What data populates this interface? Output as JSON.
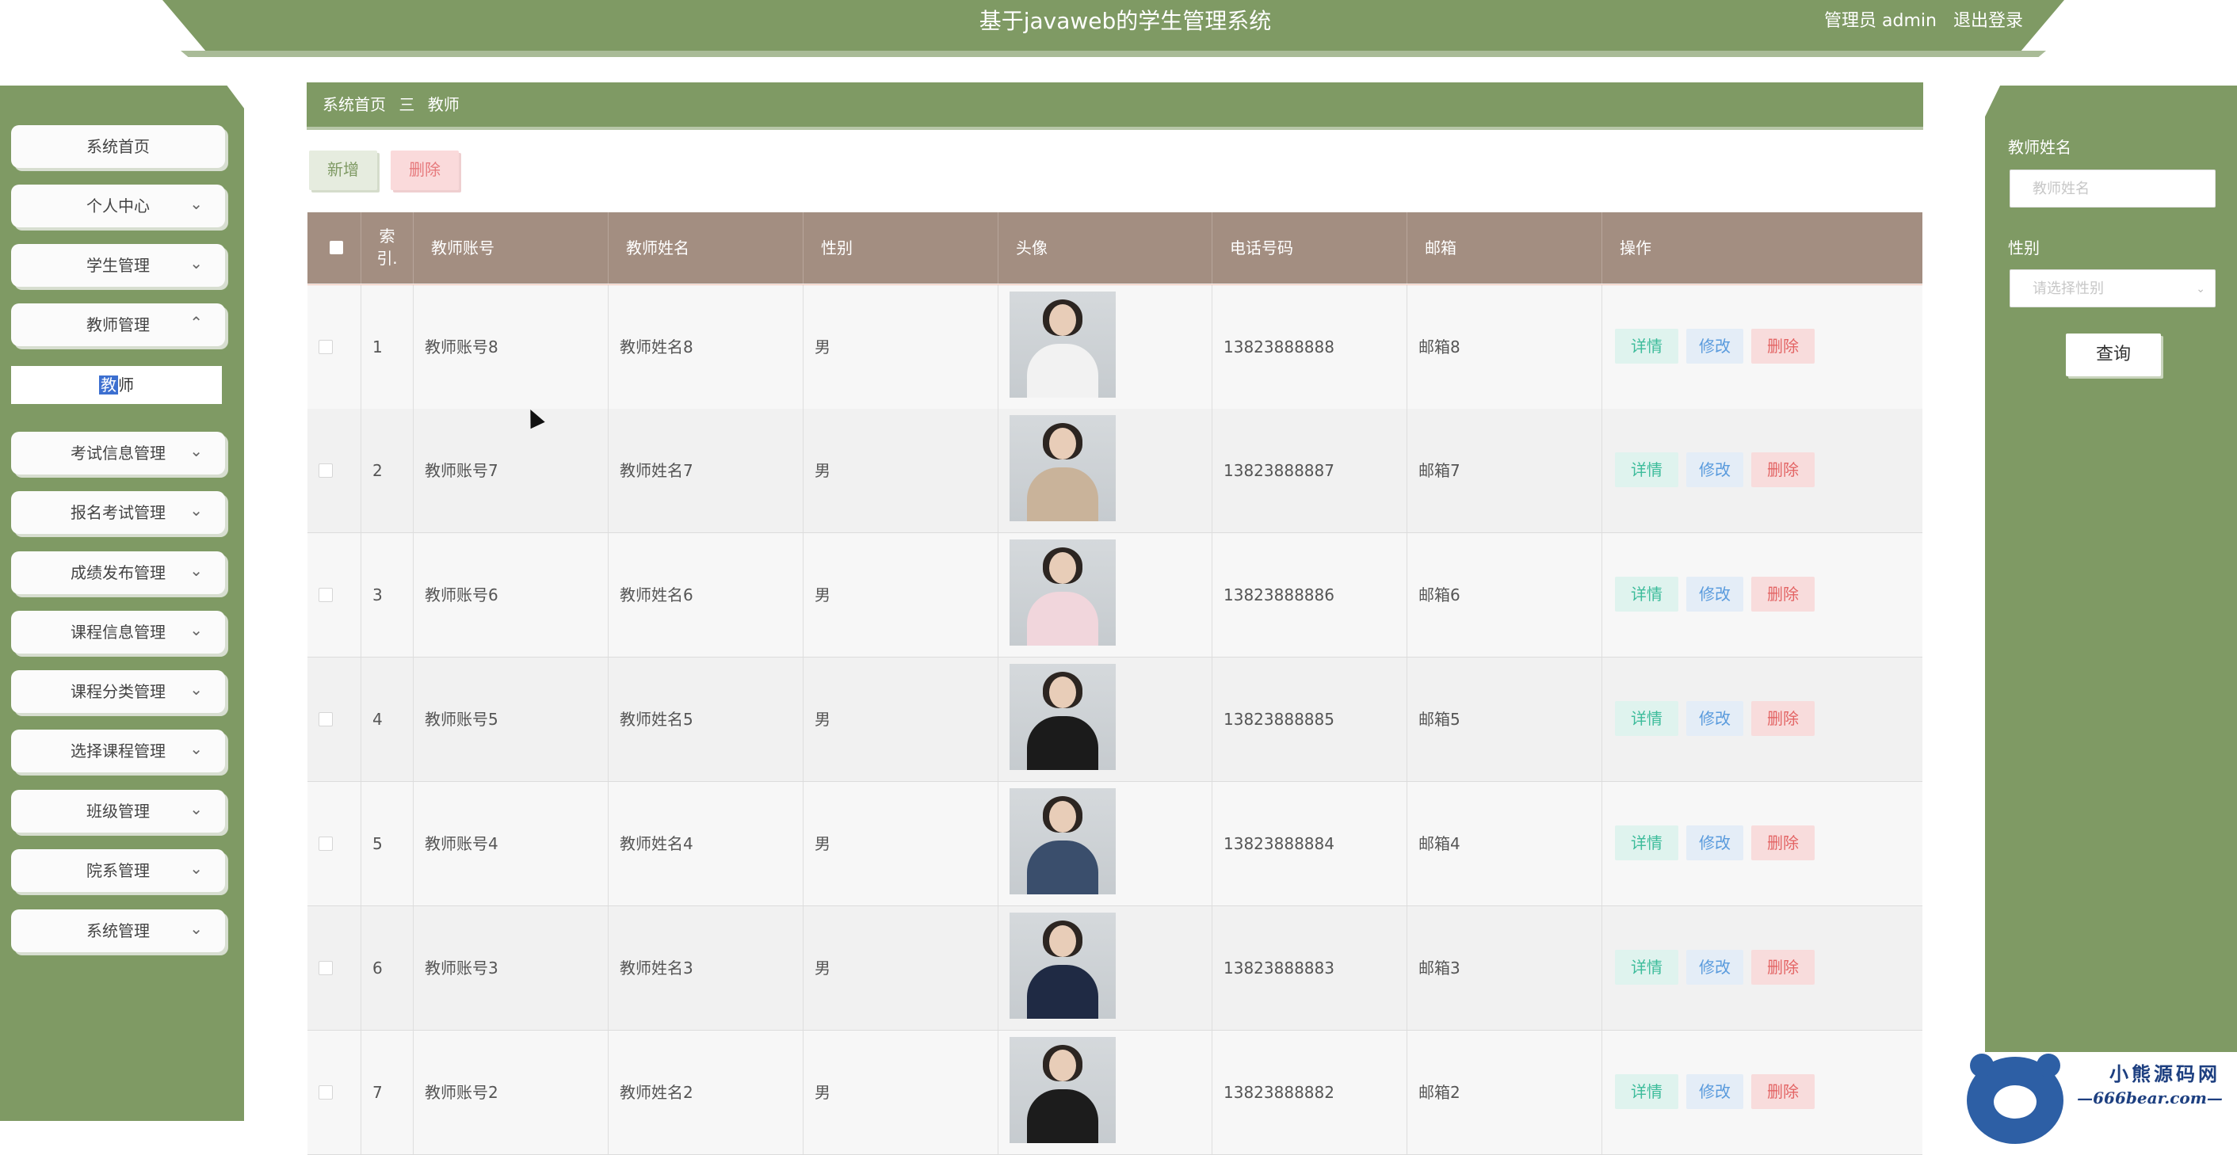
{
  "header": {
    "title": "基于javaweb的学生管理系统",
    "user_label": "管理员 admin",
    "logout_label": "退出登录"
  },
  "sidebar": {
    "items": [
      {
        "label": "系统首页",
        "expandable": false
      },
      {
        "label": "个人中心",
        "expandable": true,
        "expanded": false
      },
      {
        "label": "学生管理",
        "expandable": true,
        "expanded": false
      },
      {
        "label": "教师管理",
        "expandable": true,
        "expanded": true
      },
      {
        "label": "考试信息管理",
        "expandable": true,
        "expanded": false
      },
      {
        "label": "报名考试管理",
        "expandable": true,
        "expanded": false
      },
      {
        "label": "成绩发布管理",
        "expandable": true,
        "expanded": false
      },
      {
        "label": "课程信息管理",
        "expandable": true,
        "expanded": false
      },
      {
        "label": "课程分类管理",
        "expandable": true,
        "expanded": false
      },
      {
        "label": "选择课程管理",
        "expandable": true,
        "expanded": false
      },
      {
        "label": "班级管理",
        "expandable": true,
        "expanded": false
      },
      {
        "label": "院系管理",
        "expandable": true,
        "expanded": false
      },
      {
        "label": "系统管理",
        "expandable": true,
        "expanded": false
      }
    ],
    "sub_item": {
      "prefix_highlight": "教",
      "rest": "师"
    }
  },
  "breadcrumb": {
    "home": "系统首页",
    "separator": "三",
    "current": "教师"
  },
  "toolbar": {
    "add_label": "新增",
    "delete_label": "删除"
  },
  "table": {
    "columns": {
      "index_line1": "索",
      "index_line2": "引.",
      "account": "教师账号",
      "name": "教师姓名",
      "gender": "性别",
      "avatar": "头像",
      "phone": "电话号码",
      "email": "邮箱",
      "actions": "操作"
    },
    "rows": [
      {
        "index": "1",
        "account": "教师账号8",
        "name": "教师姓名8",
        "gender": "男",
        "phone": "13823888888",
        "email": "邮箱8"
      },
      {
        "index": "2",
        "account": "教师账号7",
        "name": "教师姓名7",
        "gender": "男",
        "phone": "13823888887",
        "email": "邮箱7"
      },
      {
        "index": "3",
        "account": "教师账号6",
        "name": "教师姓名6",
        "gender": "男",
        "phone": "13823888886",
        "email": "邮箱6"
      },
      {
        "index": "4",
        "account": "教师账号5",
        "name": "教师姓名5",
        "gender": "男",
        "phone": "13823888885",
        "email": "邮箱5"
      },
      {
        "index": "5",
        "account": "教师账号4",
        "name": "教师姓名4",
        "gender": "男",
        "phone": "13823888884",
        "email": "邮箱4"
      },
      {
        "index": "6",
        "account": "教师账号3",
        "name": "教师姓名3",
        "gender": "男",
        "phone": "13823888883",
        "email": "邮箱3"
      },
      {
        "index": "7",
        "account": "教师账号2",
        "name": "教师姓名2",
        "gender": "男",
        "phone": "13823888882",
        "email": "邮箱2"
      }
    ],
    "action_labels": {
      "detail": "详情",
      "edit": "修改",
      "delete": "删除"
    }
  },
  "search_panel": {
    "name_label": "教师姓名",
    "name_placeholder": "教师姓名",
    "gender_label": "性别",
    "gender_placeholder": "请选择性别",
    "query_button": "查询"
  },
  "watermark": {
    "line1": "小熊源码网",
    "line2": "—666bear.com—"
  },
  "colors": {
    "theme_green": "#7f9a64",
    "table_header": "#a38e81",
    "detail": "#3dbc9b",
    "edit": "#5a9bdd",
    "delete": "#e36464"
  }
}
